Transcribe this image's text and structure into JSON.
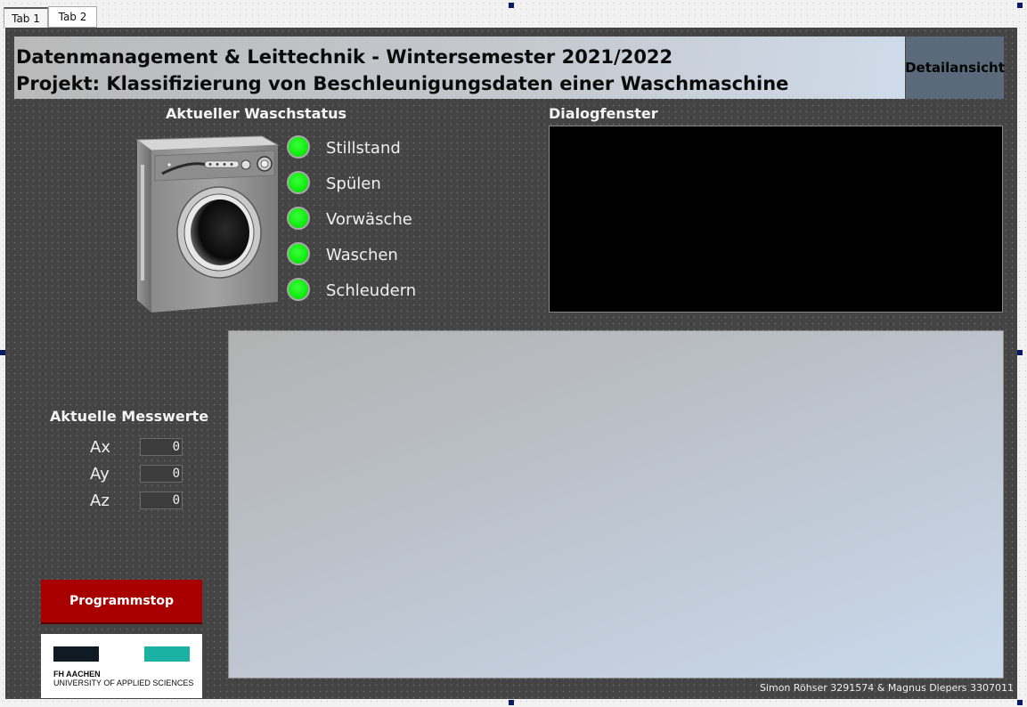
{
  "tabs": [
    {
      "label": "Tab 1",
      "active": true
    },
    {
      "label": "Tab 2",
      "active": false
    }
  ],
  "header": {
    "line1": "Datenmanagement & Leittechnik - Wintersemester 2021/2022",
    "line2": "Projekt: Klassifizierung von Beschleunigungsdaten einer Waschmaschine",
    "detail_button": "Detailansicht"
  },
  "status": {
    "title": "Aktueller Waschstatus",
    "items": [
      {
        "label": "Stillstand",
        "led_color": "#13ee13"
      },
      {
        "label": "Spülen",
        "led_color": "#13ee13"
      },
      {
        "label": "Vorwäsche",
        "led_color": "#13ee13"
      },
      {
        "label": "Waschen",
        "led_color": "#13ee13"
      },
      {
        "label": "Schleudern",
        "led_color": "#13ee13"
      }
    ]
  },
  "dialog": {
    "title": "Dialogfenster"
  },
  "measurements": {
    "title": "Aktuelle Messwerte",
    "items": [
      {
        "label": "Ax",
        "value": "0"
      },
      {
        "label": "Ay",
        "value": "0"
      },
      {
        "label": "Az",
        "value": "0"
      }
    ]
  },
  "stop_button": "Programmstop",
  "logo": {
    "line1": "FH AACHEN",
    "line2": "UNIVERSITY OF APPLIED SCIENCES",
    "colors": [
      "#0f1a23",
      "#1bb1a3"
    ]
  },
  "footer": "Simon Röhser 3291574 & Magnus Diepers 3307011",
  "colors": {
    "panel_bg": "#444444",
    "detail_button_bg": "#5b6a7b",
    "stop_button_bg": "#a80000",
    "led_on": "#13ee13"
  }
}
